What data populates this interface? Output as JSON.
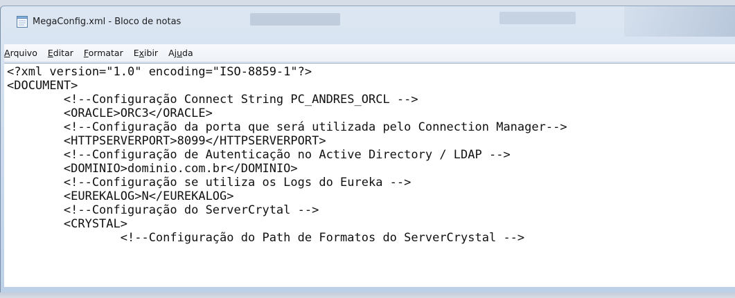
{
  "window": {
    "title": "MegaConfig.xml - Bloco de notas",
    "icon": "notepad-icon"
  },
  "menu": {
    "items": [
      {
        "label": "Arquivo",
        "mnemonic": "A"
      },
      {
        "label": "Editar",
        "mnemonic": "E"
      },
      {
        "label": "Formatar",
        "mnemonic": "F"
      },
      {
        "label": "Exibir",
        "mnemonic": "x"
      },
      {
        "label": "Ajuda",
        "mnemonic": "u"
      }
    ]
  },
  "editor": {
    "lines": [
      "<?xml version=\"1.0\" encoding=\"ISO-8859-1\"?>",
      "<DOCUMENT>",
      "        <!--Configuração Connect String PC_ANDRES_ORCL -->",
      "        <ORACLE>ORC3</ORACLE>",
      "        <!--Configuração da porta que será utilizada pelo Connection Manager-->",
      "        <HTTPSERVERPORT>8099</HTTPSERVERPORT>",
      "        <!--Configuração de Autenticação no Active Directory / LDAP -->",
      "        <DOMINIO>dominio.com.br</DOMINIO>",
      "        <!--Configuração se utiliza os Logs do Eureka -->",
      "        <EUREKALOG>N</EUREKALOG>",
      "        <!--Configuração do ServerCrytal -->",
      "        <CRYSTAL>",
      "                <!--Configuração do Path de Formatos do ServerCrystal -->"
    ]
  },
  "colors": {
    "text": "#101010",
    "editor_bg": "#ffffff",
    "menubar_bg": "#f2f5fa",
    "chrome": "#c9d9ec"
  }
}
